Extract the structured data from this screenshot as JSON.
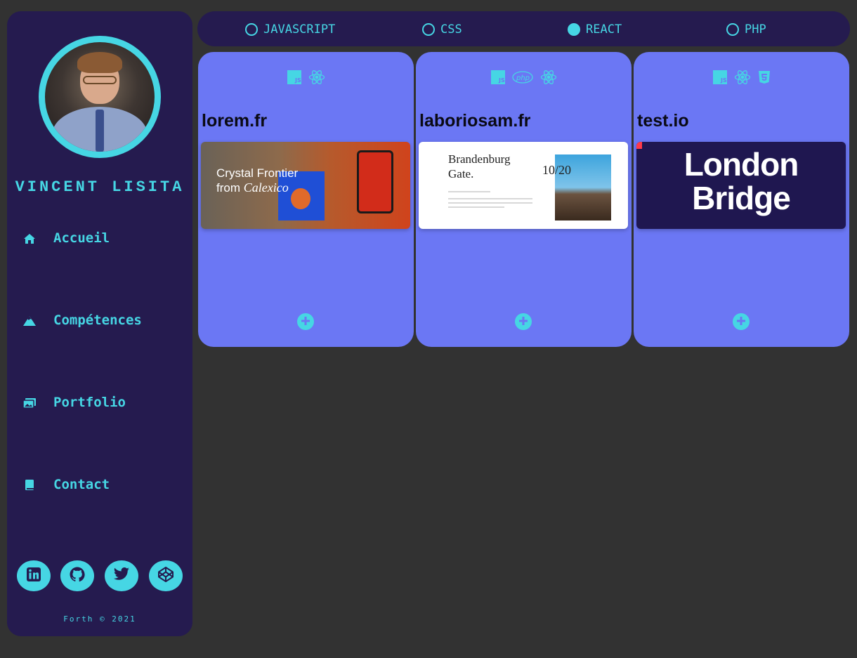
{
  "profile": {
    "name": "VINCENT LISITA"
  },
  "nav": [
    {
      "label": "Accueil",
      "icon": "home-icon"
    },
    {
      "label": "Compétences",
      "icon": "mountain-icon"
    },
    {
      "label": "Portfolio",
      "icon": "images-icon"
    },
    {
      "label": "Contact",
      "icon": "book-icon"
    }
  ],
  "socials": [
    {
      "icon": "linkedin-icon"
    },
    {
      "icon": "github-icon"
    },
    {
      "icon": "twitter-icon"
    },
    {
      "icon": "codepen-icon"
    }
  ],
  "footer": "Forth © 2021",
  "filters": [
    {
      "label": "JAVASCRIPT",
      "checked": false
    },
    {
      "label": "CSS",
      "checked": false
    },
    {
      "label": "REACT",
      "checked": true
    },
    {
      "label": "PHP",
      "checked": false
    }
  ],
  "projects": [
    {
      "title": "lorem.fr",
      "tech": [
        "js-icon",
        "react-icon"
      ],
      "screenshot": {
        "line1": "Crystal Frontier",
        "line2a": "from ",
        "line2b": "Calexico"
      }
    },
    {
      "title": "laboriosam.fr",
      "tech": [
        "js-icon",
        "php-icon",
        "react-icon"
      ],
      "screenshot": {
        "heading": "Brandenburg Gate.",
        "number": "10/20"
      }
    },
    {
      "title": "test.io",
      "tech": [
        "js-icon",
        "react-icon",
        "css3-icon"
      ],
      "screenshot": {
        "line1": "London",
        "line2": "Bridge"
      }
    }
  ],
  "colors": {
    "background": "#323232",
    "panel": "#251b4f",
    "accent": "#46d6e4",
    "card": "#6b77f4"
  }
}
